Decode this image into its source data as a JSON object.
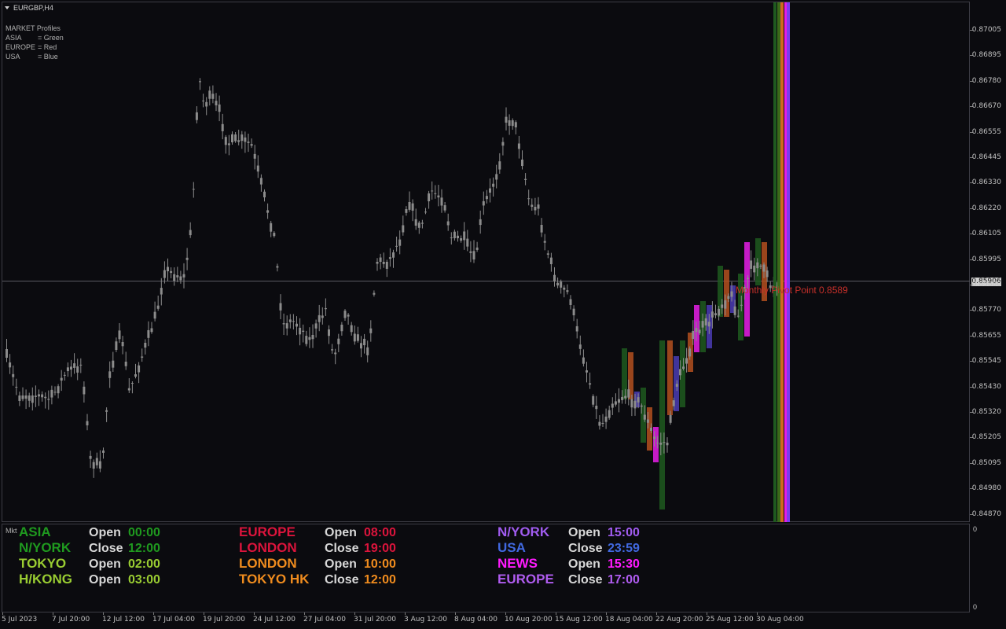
{
  "chart_header": {
    "symbol": "EURGBP,H4",
    "legend_title": "MARKET Profiles",
    "legend": [
      {
        "key": "ASIA",
        "value": "= Green"
      },
      {
        "key": "EUROPE",
        "value": "= Red"
      },
      {
        "key": "USA",
        "value": "= Blue"
      }
    ]
  },
  "current_price": "0.85906",
  "pivot_label": "Monthly Pivot Point  0.8589",
  "price_axis": [
    "0.87005",
    "0.86895",
    "0.86780",
    "0.86670",
    "0.86555",
    "0.86445",
    "0.86330",
    "0.86220",
    "0.86105",
    "0.85995",
    "0.85880",
    "0.85770",
    "0.85655",
    "0.85545",
    "0.85430",
    "0.85320",
    "0.85205",
    "0.85095",
    "0.84980",
    "0.84870"
  ],
  "time_axis": [
    "5 Jul 2023",
    "7 Jul 20:00",
    "12 Jul 12:00",
    "17 Jul 04:00",
    "19 Jul 20:00",
    "24 Jul 12:00",
    "27 Jul 04:00",
    "31 Jul 20:00",
    "3 Aug 12:00",
    "8 Aug 04:00",
    "10 Aug 20:00",
    "15 Aug 12:00",
    "18 Aug 04:00",
    "22 Aug 20:00",
    "25 Aug 12:00",
    "30 Aug 04:00"
  ],
  "subwindow": {
    "name": "Mkt",
    "scale_top": "0",
    "scale_bottom": "0",
    "sessions": [
      {
        "name": "ASIA",
        "label": "Open",
        "time": "00:00",
        "name_color": "#1f9a1f",
        "time_color": "#1f9a1f"
      },
      {
        "name": "N/YORK",
        "label": "Close",
        "time": "12:00",
        "name_color": "#1f9a1f",
        "time_color": "#1f9a1f"
      },
      {
        "name": "TOKYO",
        "label": "Open",
        "time": "02:00",
        "name_color": "#9acd32",
        "time_color": "#9acd32"
      },
      {
        "name": "H/KONG",
        "label": "Open",
        "time": "03:00",
        "name_color": "#9acd32",
        "time_color": "#9acd32"
      },
      {
        "name": "EUROPE",
        "label": "Open",
        "time": "08:00",
        "name_color": "#dc143c",
        "time_color": "#dc143c"
      },
      {
        "name": "LONDON",
        "label": "Close",
        "time": "19:00",
        "name_color": "#dc143c",
        "time_color": "#dc143c"
      },
      {
        "name": "LONDON",
        "label": "Open",
        "time": "10:00",
        "name_color": "#f08c1e",
        "time_color": "#f08c1e"
      },
      {
        "name": "TOKYO HK",
        "label": "Close",
        "time": "12:00",
        "name_color": "#f08c1e",
        "time_color": "#f08c1e"
      },
      {
        "name": "N/YORK",
        "label": "Open",
        "time": "15:00",
        "name_color": "#a15cf0",
        "time_color": "#a15cf0"
      },
      {
        "name": "USA",
        "label": "Close",
        "time": "23:59",
        "name_color": "#4169e1",
        "time_color": "#4169e1"
      },
      {
        "name": "NEWS",
        "label": "Open",
        "time": "15:30",
        "name_color": "#ff1aff",
        "time_color": "#ff1aff"
      },
      {
        "name": "EUROPE",
        "label": "Close",
        "time": "17:00",
        "name_color": "#b05cf0",
        "time_color": "#b05cf0"
      }
    ]
  },
  "colors": {
    "background": "#0b0b0f",
    "candle": "#8c8c8c",
    "session_asia": "#1f5a1f",
    "session_europe": "#b4501e",
    "session_usa": "#4b3cb4",
    "session_news": "#e61ee6"
  }
}
